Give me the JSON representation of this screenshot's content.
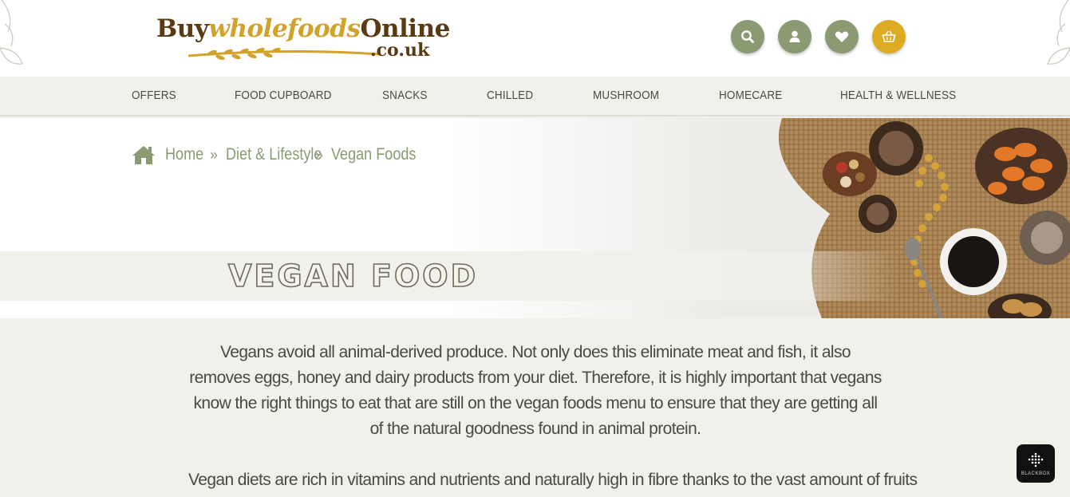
{
  "header": {
    "logo": {
      "main_dark_1": "Buy",
      "main_gold": "wholefoods",
      "main_dark_2": "Online",
      "sub": ".co.uk"
    },
    "icons": [
      {
        "name": "search-icon",
        "color": "#8a9a72"
      },
      {
        "name": "account-icon",
        "color": "#8a9a72"
      },
      {
        "name": "wishlist-heart-icon",
        "color": "#8a9a72"
      },
      {
        "name": "basket-icon",
        "color": "#dcab21"
      }
    ]
  },
  "nav": {
    "items": [
      {
        "label": "OFFERS"
      },
      {
        "label": "FOOD CUPBOARD"
      },
      {
        "label": "SNACKS"
      },
      {
        "label": "CHILLED"
      },
      {
        "label": "MUSHROOM"
      },
      {
        "label": "HOMECARE"
      },
      {
        "label": "HEALTH & WELLNESS"
      }
    ]
  },
  "breadcrumb": {
    "home": "Home",
    "separator": "»",
    "diet": "Diet & Lifestyle",
    "current": "Vegan Foods"
  },
  "page": {
    "title": "VEGAN FOOD",
    "paragraphs": [
      "Vegans avoid all animal-derived produce. Not only does this eliminate meat and fish, it also removes eggs, honey and dairy products from your diet. Therefore, it is highly important that vegans know the right things to eat that are still on the vegan foods menu to ensure that they are getting all of the natural goodness found in animal protein.",
      "Vegan diets are rich in vitamins and nutrients and naturally high in fibre thanks to the vast amount of fruits"
    ]
  },
  "widget": {
    "label": "BLACKBOX"
  },
  "colors": {
    "accent_green": "#8a9a72",
    "accent_gold": "#dcab21",
    "text_dark": "#4a4a3e",
    "band_bg": "#f1f1ec"
  }
}
